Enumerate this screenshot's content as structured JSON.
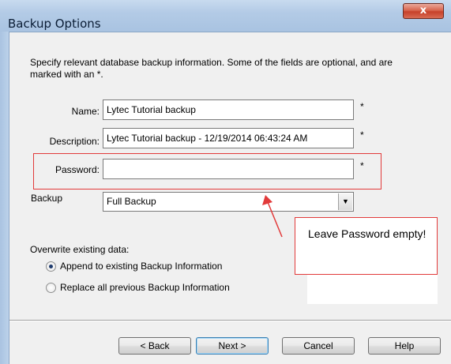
{
  "window": {
    "title": "Backup Options",
    "close_label": "x"
  },
  "intro": "Specify relevant database backup information.  Some of the fields are optional, and are marked with an *.",
  "fields": {
    "name_label": "Name:",
    "name_value": "Lytec Tutorial backup",
    "description_label": "Description:",
    "description_value": "Lytec Tutorial backup - 12/19/2014 06:43:24 AM",
    "password_label": "Password:",
    "password_value": "",
    "backup_label": "Backup",
    "backup_value": "Full Backup",
    "optional_marker": "*"
  },
  "overwrite": {
    "heading": "Overwrite existing data:",
    "options": [
      {
        "label": "Append to existing Backup Information",
        "selected": true
      },
      {
        "label": "Replace all previous Backup Information",
        "selected": false
      }
    ]
  },
  "buttons": {
    "back": "< Back",
    "next": "Next >",
    "cancel": "Cancel",
    "help": "Help"
  },
  "annotation": {
    "note": "Leave Password empty!",
    "color": "#e23a3a"
  },
  "icons": {
    "close": "close-icon",
    "dropdown": "chevron-down-icon"
  }
}
